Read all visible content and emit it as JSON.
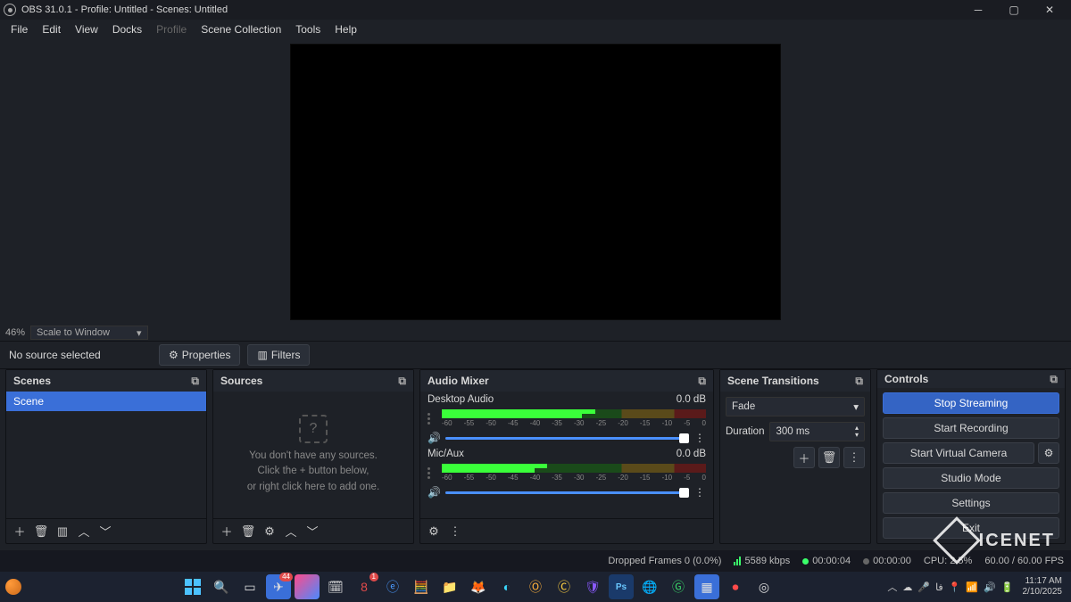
{
  "title": "OBS 31.0.1 - Profile: Untitled - Scenes: Untitled",
  "menus": {
    "file": "File",
    "edit": "Edit",
    "view": "View",
    "docks": "Docks",
    "profile": "Profile",
    "scene_collection": "Scene Collection",
    "tools": "Tools",
    "help": "Help"
  },
  "zoom": {
    "pct": "46%",
    "mode": "Scale to Window"
  },
  "nosrc": {
    "text": "No source selected",
    "properties": "Properties",
    "filters": "Filters"
  },
  "scenes": {
    "title": "Scenes",
    "items": [
      "Scene"
    ]
  },
  "sources": {
    "title": "Sources",
    "empty1": "You don't have any sources.",
    "empty2": "Click the + button below,",
    "empty3": "or right click here to add one."
  },
  "audio": {
    "title": "Audio Mixer",
    "channels": [
      {
        "name": "Desktop Audio",
        "db": "0.0 dB",
        "level": 58
      },
      {
        "name": "Mic/Aux",
        "db": "0.0 dB",
        "level": 40
      }
    ],
    "ticks": [
      "-60",
      "-55",
      "-50",
      "-45",
      "-40",
      "-35",
      "-30",
      "-25",
      "-20",
      "-15",
      "-10",
      "-5",
      "0"
    ]
  },
  "trans": {
    "title": "Scene Transitions",
    "type": "Fade",
    "dur_label": "Duration",
    "dur_val": "300 ms"
  },
  "ctrl": {
    "title": "Controls",
    "stop_stream": "Stop Streaming",
    "start_rec": "Start Recording",
    "virt_cam": "Start Virtual Camera",
    "studio": "Studio Mode",
    "settings": "Settings",
    "exit": "Exit"
  },
  "status": {
    "drops": "Dropped Frames 0 (0.0%)",
    "kbps": "5589 kbps",
    "live": "00:00:04",
    "rec": "00:00:00",
    "cpu": "CPU: 2.5%",
    "fps": "60.00 / 60.00 FPS"
  },
  "taskbar": {
    "time": "11:17 AM",
    "date": "2/10/2025",
    "lang": "فا"
  },
  "watermark": "ICENET"
}
